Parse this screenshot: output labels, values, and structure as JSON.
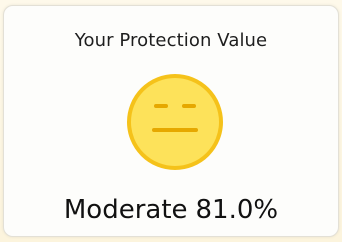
{
  "panel": {
    "title": "Your Protection Value",
    "status_label": "Moderate",
    "value_text": "81.0%",
    "face_icon": "neutral-face-icon"
  },
  "colors": {
    "face_fill": "#fde25a",
    "face_stroke": "#f5c21a",
    "face_features": "#e6a800"
  }
}
